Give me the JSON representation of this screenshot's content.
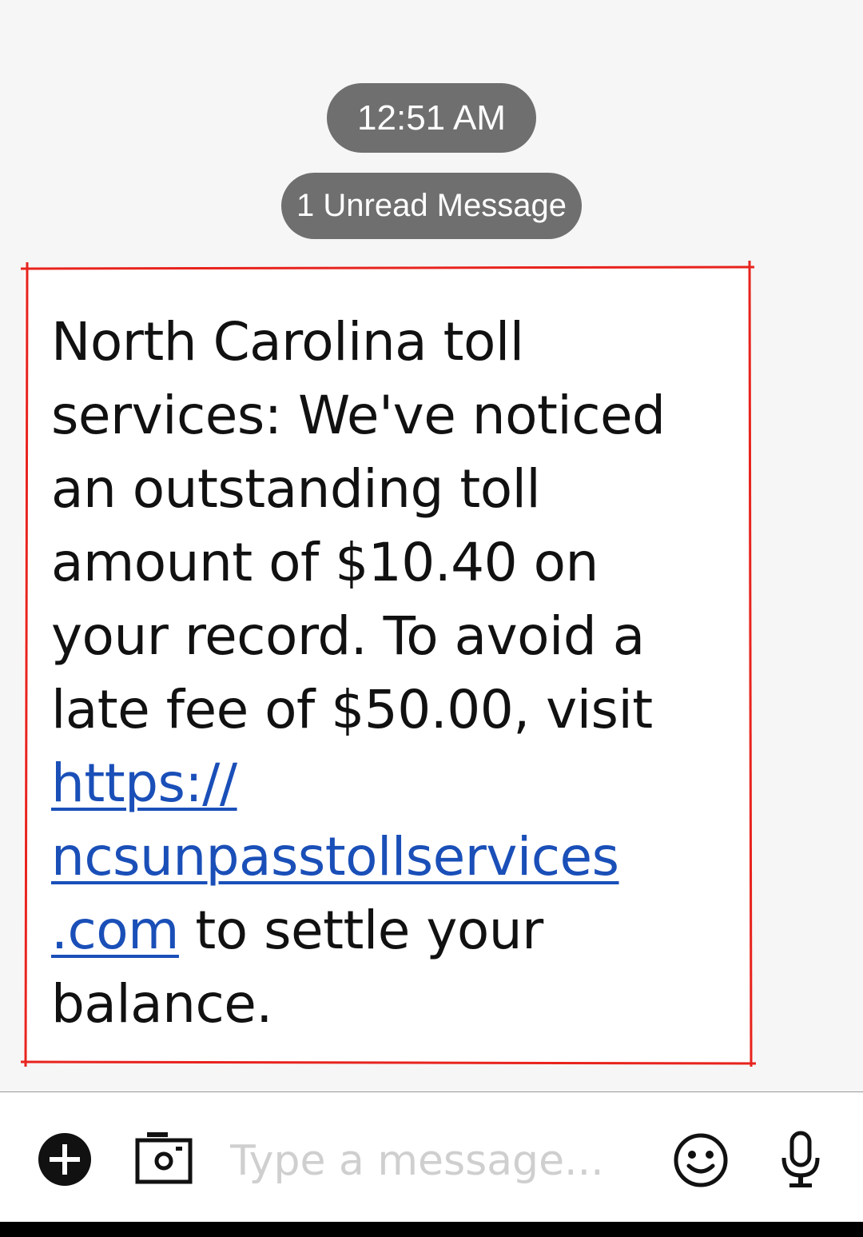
{
  "conversation": {
    "timestamp": "12:51 AM",
    "unread_label": "1 Unread Message",
    "message": {
      "text_before_link": "North Carolina toll services: We've noticed an outstanding toll amount of $10.40 on your record. To avoid a late fee of $50.00, visit ",
      "link_line1": "https://",
      "link_line2": "ncsunpasstollservices",
      "link_line3": ".com",
      "text_after_link": " to settle your balance."
    }
  },
  "composer": {
    "placeholder": "Type a message...",
    "icons": {
      "add": "plus-icon",
      "camera": "camera-icon",
      "emoji": "emoji-icon",
      "voice": "mic-icon"
    }
  },
  "colors": {
    "background": "#f6f6f6",
    "pill": "#6f6f6f",
    "link": "#1a4fb8",
    "annotation": "#e8231d",
    "placeholder": "#cfcfcf"
  }
}
